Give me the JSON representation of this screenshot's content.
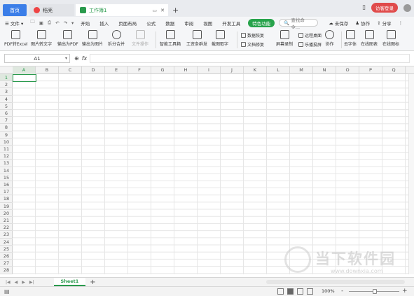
{
  "titlebar": {
    "tab_home": "首页",
    "tab_docer": "稻壳",
    "tab_book": "工作簿1",
    "login": "访客登录"
  },
  "menubar": {
    "file": "文件",
    "items": [
      "开始",
      "插入",
      "页面布局",
      "公式",
      "数据",
      "审阅",
      "视图",
      "开发工具"
    ],
    "feature": "特色功能",
    "search": "查找命令...",
    "unsaved": "未保存",
    "collab": "协作",
    "share": "分享"
  },
  "toolbar": {
    "pdf_to_excel": "PDF转Excel",
    "img_to_text": "图片转文字",
    "export_pdf": "输出为PDF",
    "export_img": "输出为图片",
    "split_merge": "拆分合并",
    "file_ops": "文件操作",
    "smart_toolbox": "智能工具箱",
    "payroll": "工资条群发",
    "screenshot_ocr": "截图取字",
    "data_recovery": "数据恢复",
    "doc_repair": "文档修复",
    "screen_record": "屏幕录制",
    "remote_desktop": "远程桌面",
    "cast": "乐播投屏",
    "collab": "协作",
    "cloud_font": "云字体",
    "online_chart": "在线图表",
    "online_icon": "在线图标"
  },
  "formulabar": {
    "cell_ref": "A1",
    "fx": "fx"
  },
  "grid": {
    "columns": [
      "A",
      "B",
      "C",
      "D",
      "E",
      "F",
      "G",
      "H",
      "I",
      "J",
      "K",
      "L",
      "M",
      "N",
      "O",
      "P",
      "Q"
    ],
    "rows": [
      "1",
      "2",
      "3",
      "4",
      "5",
      "6",
      "7",
      "8",
      "9",
      "10",
      "11",
      "12",
      "13",
      "14",
      "15",
      "16",
      "17",
      "18",
      "19",
      "20",
      "21",
      "22",
      "23",
      "24",
      "25",
      "26",
      "27",
      "28"
    ]
  },
  "sheets": {
    "sheet1": "Sheet1",
    "add": "+"
  },
  "statusbar": {
    "zoom": "100%",
    "minus": "-",
    "plus": "+"
  },
  "watermark": {
    "text": "当下软件园",
    "url": "www.downxia.com"
  }
}
